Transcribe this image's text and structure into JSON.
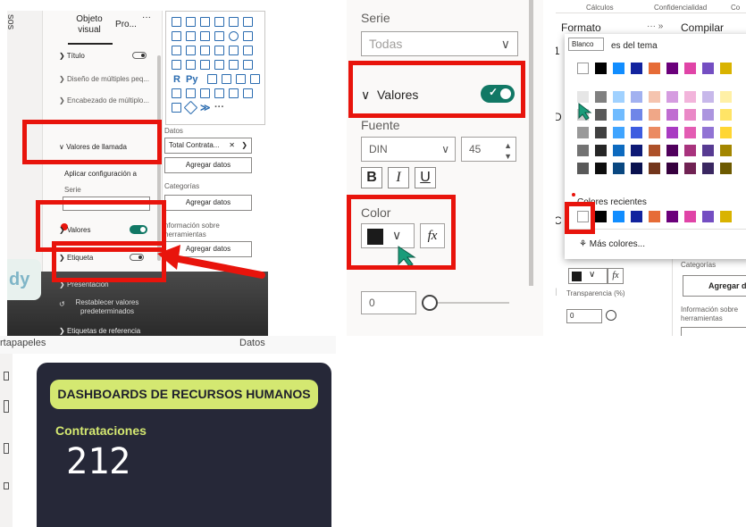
{
  "panel1": {
    "side_tab": "sos",
    "tabs": [
      "Objeto visual",
      "Pro..."
    ],
    "more": "···",
    "rows": {
      "titulo": "Título",
      "diseno": "Diseño de múltiples peq...",
      "encabezado": "Encabezado de múltiplo...",
      "valores_llamada": "Valores de llamada",
      "aplicar": "Aplicar configuración a",
      "serie": "Serie",
      "valores": "Valores",
      "etiqueta": "Etiqueta",
      "presentacion": "Presentación",
      "restablecer": "Restablecer valores predeterminados",
      "etiquetas_ref": "Etiquetas de referencia"
    },
    "viz_text": {
      "r": "R",
      "py": "Py",
      "more": "···"
    },
    "datos_label": "Datos",
    "datos_field": "Total Contrata...",
    "datos_field_close": "✕",
    "datos_field_chevron": "❯",
    "add_data": "Agregar datos",
    "categorias": "Categorías",
    "info_label": "nformación sobre herramientas",
    "logo_text": "dy"
  },
  "panel2": {
    "serie_label": "Serie",
    "serie_value": "Todas",
    "valores_label": "Valores",
    "fuente_label": "Fuente",
    "font_name": "DIN",
    "font_size": "45",
    "bold": "B",
    "italic": "I",
    "underline": "U",
    "color_label": "Color",
    "fx": "fx",
    "transparency_value": "0",
    "chevron": "∨",
    "checkmark": "✓"
  },
  "panel3": {
    "top_labels": [
      "Cálculos",
      "Confidencialidad",
      "Co"
    ],
    "formato": "Formato",
    "more": "··· »",
    "compilar": "Compilar",
    "tooltip": "Blanco",
    "theme_colors_label": "es del tema",
    "recent_colors_label": "Colores recientes",
    "more_colors": "Más colores...",
    "categorias": "Categorías",
    "agregar": "Agregar d",
    "transparencia": "Transparencia (%)",
    "info": "Información sobre herramientas",
    "transparency_value": "0",
    "fx": "fx",
    "side_letters": [
      "1",
      "D",
      "C",
      "I"
    ],
    "theme_row1": [
      "#ffffff",
      "#000000",
      "#118dff",
      "#12239e",
      "#e66c37",
      "#6b007b",
      "#e044a7",
      "#744ec2",
      "#d9b300"
    ],
    "theme_rows": [
      [
        "#e6e6e6",
        "#808080",
        "#a0d1ff",
        "#a2b1f0",
        "#f5c4af",
        "#d59ce0",
        "#f2b4db",
        "#c7b8ea",
        "#fff0a6"
      ],
      [
        "#cccccc",
        "#595959",
        "#70bbff",
        "#6f86e8",
        "#f0a787",
        "#c06dd1",
        "#ea88c7",
        "#ac95df",
        "#ffe466"
      ],
      [
        "#999999",
        "#404040",
        "#3fa4ff",
        "#3d5ce0",
        "#eb8a61",
        "#a93bc2",
        "#e35cb3",
        "#9173d4",
        "#ffd633"
      ],
      [
        "#737373",
        "#262626",
        "#0d6abf",
        "#0e1a76",
        "#ad5129",
        "#50005c",
        "#a8337d",
        "#573b92",
        "#a38600"
      ],
      [
        "#595959",
        "#0d0d0d",
        "#094780",
        "#09114f",
        "#73361c",
        "#36003e",
        "#702253",
        "#3a2761",
        "#6d5a00"
      ]
    ],
    "recent_row": [
      "#ffffff",
      "#000000",
      "#118dff",
      "#12239e",
      "#e66c37",
      "#6b007b",
      "#e044a7",
      "#744ec2",
      "#d9b300"
    ]
  },
  "panel4": {
    "portapapeles": "rtapapeles",
    "datos": "Datos",
    "dashboard_title": "DASHBOARDS DE RECURSOS HUMANOS",
    "kpi_label": "Contrataciones",
    "kpi_value": "212"
  },
  "colors": {
    "highlight_red": "#e8140c",
    "toggle_green": "#117865",
    "card_bg": "#262838",
    "pill_bg": "#d4e871",
    "kpi_label": "#d4e871"
  }
}
